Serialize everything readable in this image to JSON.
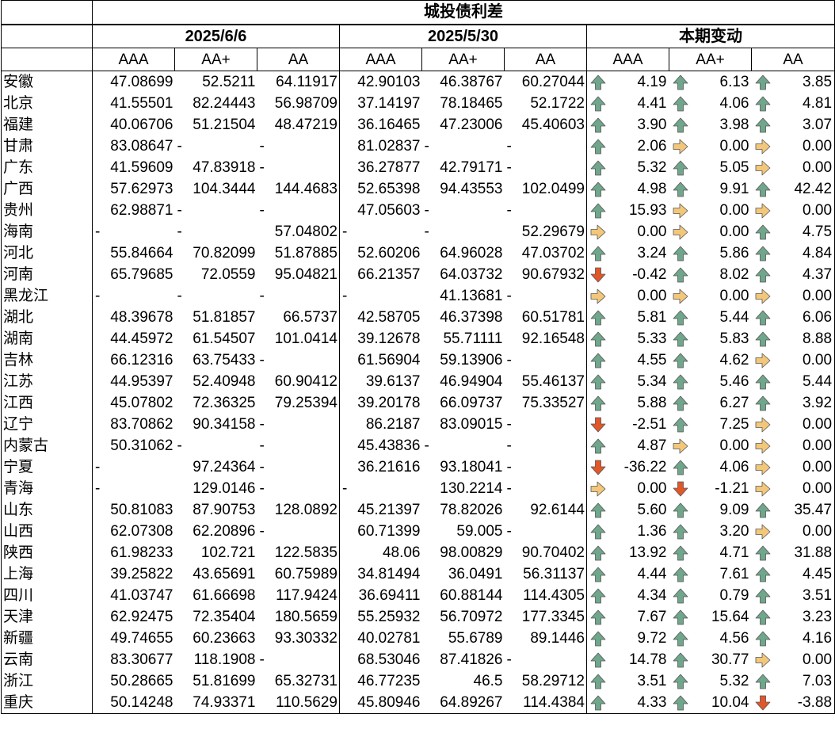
{
  "title": "城投债利差",
  "groups": [
    "2025/6/6",
    "2025/5/30",
    "本期变动"
  ],
  "ratings": [
    "AAA",
    "AA+",
    "AA"
  ],
  "colors": {
    "up": "#6fa68c",
    "down": "#e0572a",
    "flat": "#f3c77a"
  },
  "rows": [
    {
      "region": "安徽",
      "d1": [
        "47.08699",
        "52.5211",
        "64.11917"
      ],
      "d2": [
        "42.90103",
        "46.38767",
        "60.27044"
      ],
      "chg": [
        "4.19",
        "6.13",
        "3.85"
      ],
      "dir": [
        "up",
        "up",
        "up"
      ]
    },
    {
      "region": "北京",
      "d1": [
        "41.55501",
        "82.24443",
        "56.98709"
      ],
      "d2": [
        "37.14197",
        "78.18465",
        "52.1722"
      ],
      "chg": [
        "4.41",
        "4.06",
        "4.81"
      ],
      "dir": [
        "up",
        "up",
        "up"
      ]
    },
    {
      "region": "福建",
      "d1": [
        "40.06706",
        "51.21504",
        "48.47219"
      ],
      "d2": [
        "36.16465",
        "47.23006",
        "45.40603"
      ],
      "chg": [
        "3.90",
        "3.98",
        "3.07"
      ],
      "dir": [
        "up",
        "up",
        "up"
      ]
    },
    {
      "region": "甘肃",
      "d1": [
        "83.08647",
        "-",
        "-"
      ],
      "d2": [
        "81.02837",
        "-",
        "-"
      ],
      "chg": [
        "2.06",
        "0.00",
        "0.00"
      ],
      "dir": [
        "up",
        "flat",
        "flat"
      ]
    },
    {
      "region": "广东",
      "d1": [
        "41.59609",
        "47.83918",
        "-"
      ],
      "d2": [
        "36.27877",
        "42.79171",
        "-"
      ],
      "chg": [
        "5.32",
        "5.05",
        "0.00"
      ],
      "dir": [
        "up",
        "up",
        "flat"
      ]
    },
    {
      "region": "广西",
      "d1": [
        "57.62973",
        "104.3444",
        "144.4683"
      ],
      "d2": [
        "52.65398",
        "94.43553",
        "102.0499"
      ],
      "chg": [
        "4.98",
        "9.91",
        "42.42"
      ],
      "dir": [
        "up",
        "up",
        "up"
      ]
    },
    {
      "region": "贵州",
      "d1": [
        "62.98871",
        "-",
        "-"
      ],
      "d2": [
        "47.05603",
        "-",
        "-"
      ],
      "chg": [
        "15.93",
        "0.00",
        "0.00"
      ],
      "dir": [
        "up",
        "flat",
        "flat"
      ]
    },
    {
      "region": "海南",
      "d1": [
        "-",
        "-",
        "57.04802"
      ],
      "d2": [
        "-",
        "-",
        "52.29679"
      ],
      "chg": [
        "0.00",
        "0.00",
        "4.75"
      ],
      "dir": [
        "flat",
        "flat",
        "up"
      ]
    },
    {
      "region": "河北",
      "d1": [
        "55.84664",
        "70.82099",
        "51.87885"
      ],
      "d2": [
        "52.60206",
        "64.96028",
        "47.03702"
      ],
      "chg": [
        "3.24",
        "5.86",
        "4.84"
      ],
      "dir": [
        "up",
        "up",
        "up"
      ]
    },
    {
      "region": "河南",
      "d1": [
        "65.79685",
        "72.0559",
        "95.04821"
      ],
      "d2": [
        "66.21357",
        "64.03732",
        "90.67932"
      ],
      "chg": [
        "-0.42",
        "8.02",
        "4.37"
      ],
      "dir": [
        "down",
        "up",
        "up"
      ]
    },
    {
      "region": "黑龙江",
      "d1": [
        "-",
        "-",
        "-"
      ],
      "d2": [
        "-",
        "41.13681",
        "-"
      ],
      "chg": [
        "0.00",
        "0.00",
        "0.00"
      ],
      "dir": [
        "flat",
        "flat",
        "flat"
      ]
    },
    {
      "region": "湖北",
      "d1": [
        "48.39678",
        "51.81857",
        "66.5737"
      ],
      "d2": [
        "42.58705",
        "46.37398",
        "60.51781"
      ],
      "chg": [
        "5.81",
        "5.44",
        "6.06"
      ],
      "dir": [
        "up",
        "up",
        "up"
      ]
    },
    {
      "region": "湖南",
      "d1": [
        "44.45972",
        "61.54507",
        "101.0414"
      ],
      "d2": [
        "39.12678",
        "55.71111",
        "92.16548"
      ],
      "chg": [
        "5.33",
        "5.83",
        "8.88"
      ],
      "dir": [
        "up",
        "up",
        "up"
      ]
    },
    {
      "region": "吉林",
      "d1": [
        "66.12316",
        "63.75433",
        "-"
      ],
      "d2": [
        "61.56904",
        "59.13906",
        "-"
      ],
      "chg": [
        "4.55",
        "4.62",
        "0.00"
      ],
      "dir": [
        "up",
        "up",
        "flat"
      ]
    },
    {
      "region": "江苏",
      "d1": [
        "44.95397",
        "52.40948",
        "60.90412"
      ],
      "d2": [
        "39.6137",
        "46.94904",
        "55.46137"
      ],
      "chg": [
        "5.34",
        "5.46",
        "5.44"
      ],
      "dir": [
        "up",
        "up",
        "up"
      ]
    },
    {
      "region": "江西",
      "d1": [
        "45.07802",
        "72.36325",
        "79.25394"
      ],
      "d2": [
        "39.20178",
        "66.09737",
        "75.33527"
      ],
      "chg": [
        "5.88",
        "6.27",
        "3.92"
      ],
      "dir": [
        "up",
        "up",
        "up"
      ]
    },
    {
      "region": "辽宁",
      "d1": [
        "83.70862",
        "90.34158",
        "-"
      ],
      "d2": [
        "86.2187",
        "83.09015",
        "-"
      ],
      "chg": [
        "-2.51",
        "7.25",
        "0.00"
      ],
      "dir": [
        "down",
        "up",
        "flat"
      ]
    },
    {
      "region": "内蒙古",
      "d1": [
        "50.31062",
        "-",
        "-"
      ],
      "d2": [
        "45.43836",
        "-",
        "-"
      ],
      "chg": [
        "4.87",
        "0.00",
        "0.00"
      ],
      "dir": [
        "up",
        "flat",
        "flat"
      ]
    },
    {
      "region": "宁夏",
      "d1": [
        "-",
        "97.24364",
        "-"
      ],
      "d2": [
        "36.21616",
        "93.18041",
        "-"
      ],
      "chg": [
        "-36.22",
        "4.06",
        "0.00"
      ],
      "dir": [
        "down",
        "up",
        "flat"
      ]
    },
    {
      "region": "青海",
      "d1": [
        "-",
        "129.0146",
        "-"
      ],
      "d2": [
        "-",
        "130.2214",
        "-"
      ],
      "chg": [
        "0.00",
        "-1.21",
        "0.00"
      ],
      "dir": [
        "flat",
        "down",
        "flat"
      ]
    },
    {
      "region": "山东",
      "d1": [
        "50.81083",
        "87.90753",
        "128.0892"
      ],
      "d2": [
        "45.21397",
        "78.82026",
        "92.6144"
      ],
      "chg": [
        "5.60",
        "9.09",
        "35.47"
      ],
      "dir": [
        "up",
        "up",
        "up"
      ]
    },
    {
      "region": "山西",
      "d1": [
        "62.07308",
        "62.20896",
        "-"
      ],
      "d2": [
        "60.71399",
        "59.005",
        "-"
      ],
      "chg": [
        "1.36",
        "3.20",
        "0.00"
      ],
      "dir": [
        "up",
        "up",
        "flat"
      ]
    },
    {
      "region": "陕西",
      "d1": [
        "61.98233",
        "102.721",
        "122.5835"
      ],
      "d2": [
        "48.06",
        "98.00829",
        "90.70402"
      ],
      "chg": [
        "13.92",
        "4.71",
        "31.88"
      ],
      "dir": [
        "up",
        "up",
        "up"
      ]
    },
    {
      "region": "上海",
      "d1": [
        "39.25822",
        "43.65691",
        "60.75989"
      ],
      "d2": [
        "34.81494",
        "36.0491",
        "56.31137"
      ],
      "chg": [
        "4.44",
        "7.61",
        "4.45"
      ],
      "dir": [
        "up",
        "up",
        "up"
      ]
    },
    {
      "region": "四川",
      "d1": [
        "41.03747",
        "61.66698",
        "117.9424"
      ],
      "d2": [
        "36.69411",
        "60.88144",
        "114.4305"
      ],
      "chg": [
        "4.34",
        "0.79",
        "3.51"
      ],
      "dir": [
        "up",
        "up",
        "up"
      ]
    },
    {
      "region": "天津",
      "d1": [
        "62.92475",
        "72.35404",
        "180.5659"
      ],
      "d2": [
        "55.25932",
        "56.70972",
        "177.3345"
      ],
      "chg": [
        "7.67",
        "15.64",
        "3.23"
      ],
      "dir": [
        "up",
        "up",
        "up"
      ]
    },
    {
      "region": "新疆",
      "d1": [
        "49.74655",
        "60.23663",
        "93.30332"
      ],
      "d2": [
        "40.02781",
        "55.6789",
        "89.1446"
      ],
      "chg": [
        "9.72",
        "4.56",
        "4.16"
      ],
      "dir": [
        "up",
        "up",
        "up"
      ]
    },
    {
      "region": "云南",
      "d1": [
        "83.30677",
        "118.1908",
        "-"
      ],
      "d2": [
        "68.53046",
        "87.41826",
        "-"
      ],
      "chg": [
        "14.78",
        "30.77",
        "0.00"
      ],
      "dir": [
        "up",
        "up",
        "flat"
      ]
    },
    {
      "region": "浙江",
      "d1": [
        "50.28665",
        "51.81699",
        "65.32731"
      ],
      "d2": [
        "46.77235",
        "46.5",
        "58.29712"
      ],
      "chg": [
        "3.51",
        "5.32",
        "7.03"
      ],
      "dir": [
        "up",
        "up",
        "up"
      ]
    },
    {
      "region": "重庆",
      "d1": [
        "50.14248",
        "74.93371",
        "110.5629"
      ],
      "d2": [
        "45.80946",
        "64.89267",
        "114.4384"
      ],
      "chg": [
        "4.33",
        "10.04",
        "-3.88"
      ],
      "dir": [
        "up",
        "up",
        "down"
      ]
    }
  ]
}
